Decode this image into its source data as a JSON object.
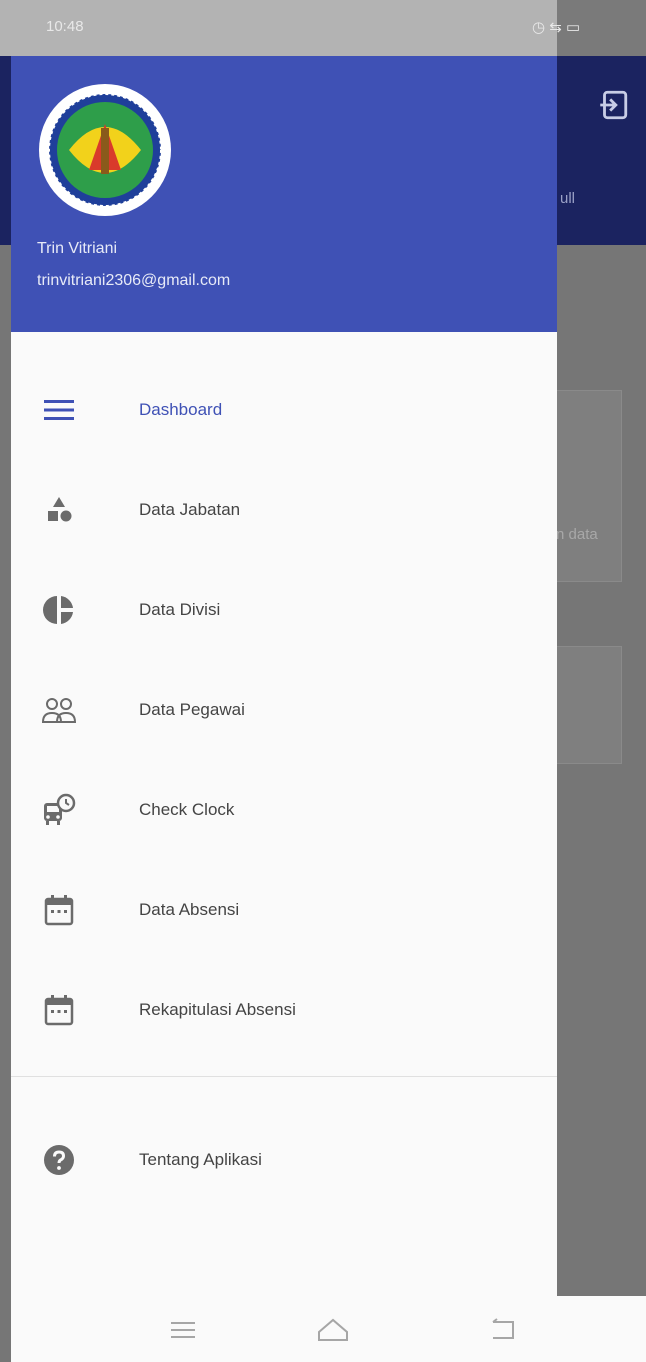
{
  "status_bar": {
    "time": "10:48",
    "icons": "◷ ⇆ ▭"
  },
  "background": {
    "tab_text": "ull",
    "card_text": "n data"
  },
  "drawer": {
    "user": {
      "name": "Trin Vitriani",
      "email": "trinvitriani2306@gmail.com"
    },
    "items": [
      {
        "label": "Dashboard",
        "icon": "menu-icon",
        "active": true
      },
      {
        "label": "Data Jabatan",
        "icon": "shapes-icon",
        "active": false
      },
      {
        "label": "Data Divisi",
        "icon": "pie-chart-icon",
        "active": false
      },
      {
        "label": "Data Pegawai",
        "icon": "people-icon",
        "active": false
      },
      {
        "label": "Check Clock",
        "icon": "bus-clock-icon",
        "active": false
      },
      {
        "label": "Data Absensi",
        "icon": "calendar-icon",
        "active": false
      },
      {
        "label": "Rekapitulasi Absensi",
        "icon": "calendar-icon",
        "active": false
      }
    ],
    "about": {
      "label": "Tentang Aplikasi",
      "icon": "help-icon"
    }
  },
  "colors": {
    "primary": "#3f51b5",
    "appbar_dim": "#1b2360",
    "icon_gray": "#6b6b6b"
  }
}
